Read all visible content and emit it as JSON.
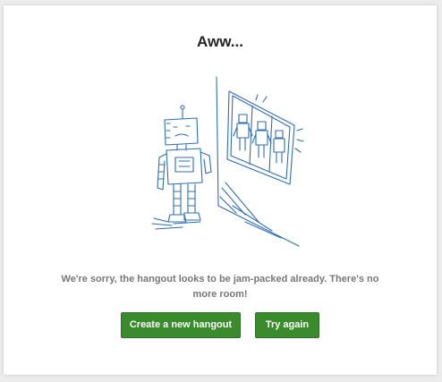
{
  "dialog": {
    "title": "Aww...",
    "message": "We're sorry, the hangout looks to be jam-packed already. There's no more room!",
    "create_button_label": "Create a new hangout",
    "retry_button_label": "Try again"
  },
  "colors": {
    "button_green": "#3a8b2c",
    "illustration_blue": "#2f6db3",
    "message_gray": "#777777"
  },
  "illustration": {
    "icon": "sad-robot-window-icon"
  }
}
